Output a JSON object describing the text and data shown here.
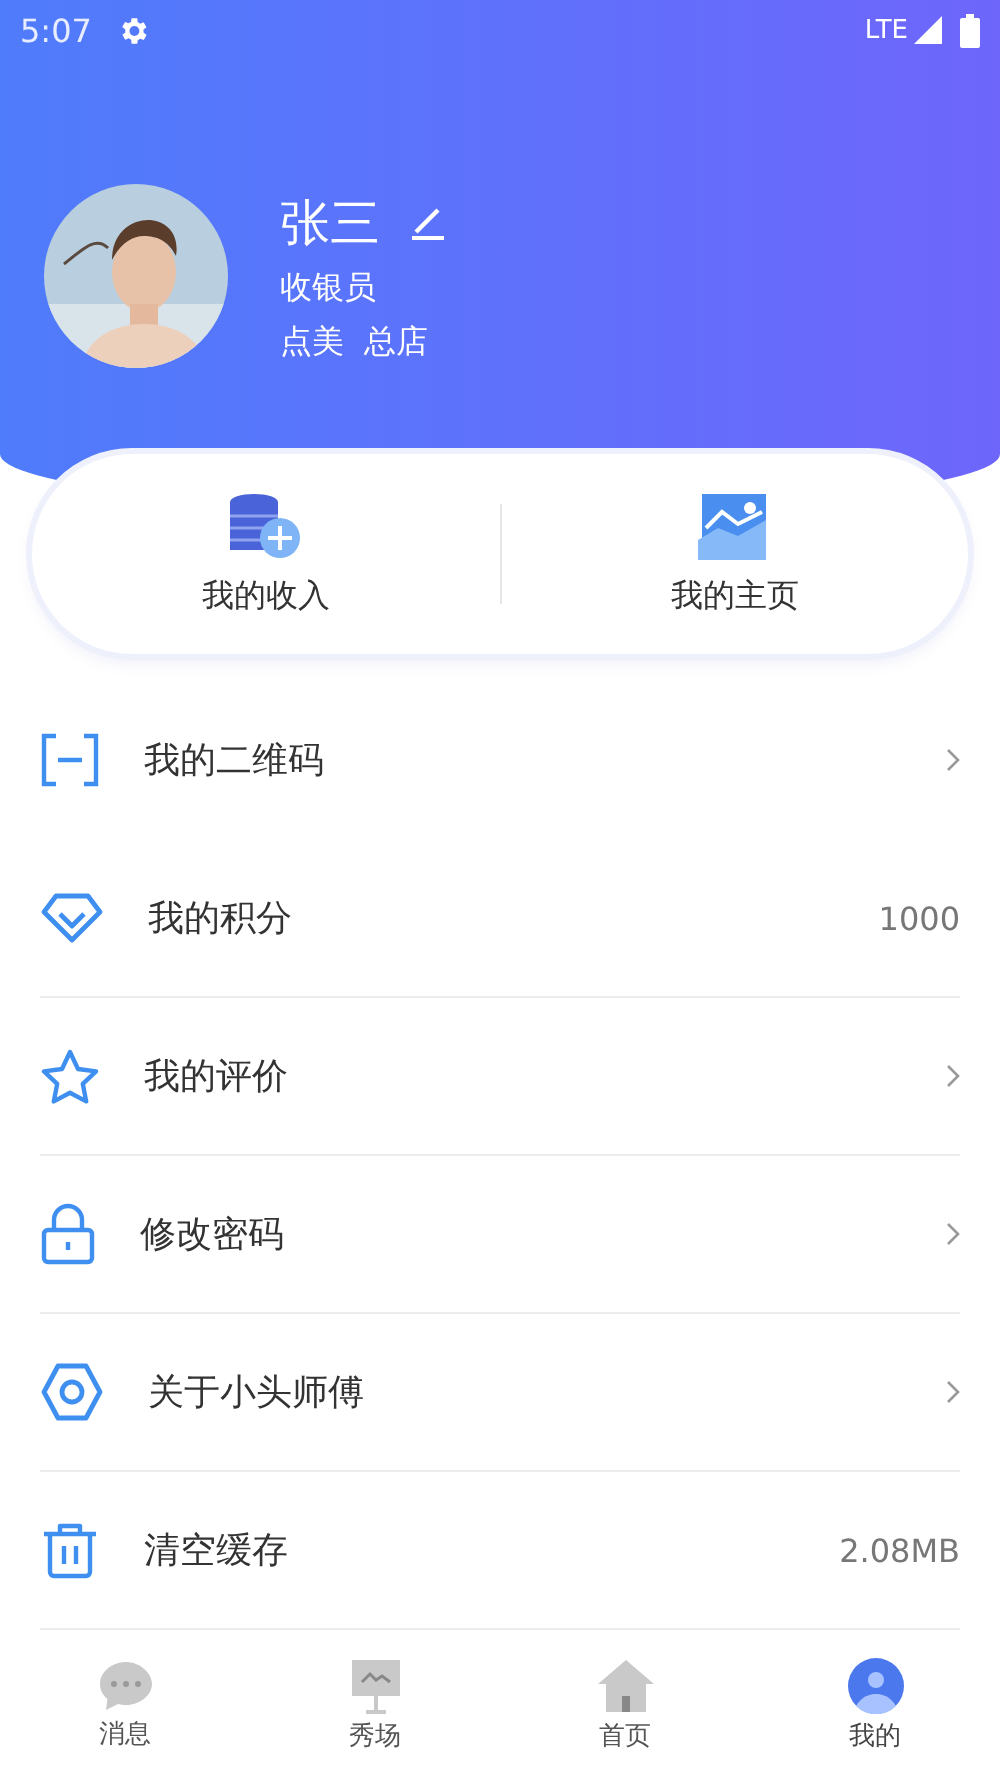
{
  "status_bar": {
    "time": "5:07",
    "network": "LTE"
  },
  "profile": {
    "name": "张三",
    "role": "收银员",
    "store": "点美  总店"
  },
  "shortcuts": [
    {
      "label": "我的收入"
    },
    {
      "label": "我的主页"
    }
  ],
  "menu": [
    {
      "label": "我的二维码",
      "kind": "chevron",
      "divider": false
    },
    {
      "label": "我的积分",
      "kind": "value",
      "value": "1000",
      "divider": true
    },
    {
      "label": "我的评价",
      "kind": "chevron",
      "divider": true
    },
    {
      "label": "修改密码",
      "kind": "chevron",
      "divider": true
    },
    {
      "label": "关于小头师傅",
      "kind": "chevron",
      "divider": true
    },
    {
      "label": "清空缓存",
      "kind": "value",
      "value": "2.08MB",
      "divider": true
    }
  ],
  "bottom_nav": [
    {
      "label": "消息",
      "selected": false
    },
    {
      "label": "秀场",
      "selected": false
    },
    {
      "label": "首页",
      "selected": false
    },
    {
      "label": "我的",
      "selected": true
    }
  ]
}
